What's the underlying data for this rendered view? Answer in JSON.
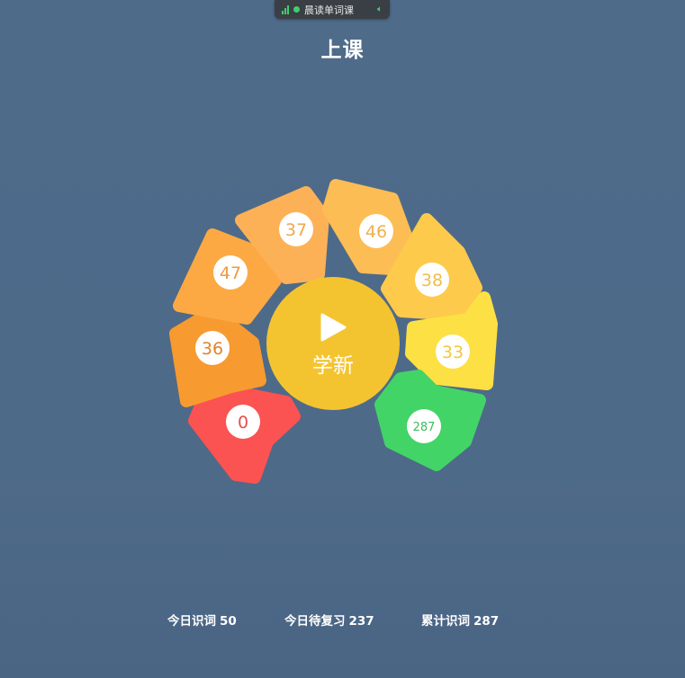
{
  "top_bar": {
    "app_name": "晨读单词课"
  },
  "page_title": "上课",
  "center_button": {
    "label": "学新",
    "color": "#f4c430"
  },
  "segments": [
    {
      "name": "0",
      "count": "0",
      "color": "#fb5252",
      "num_color": "#e4504c"
    },
    {
      "name": "36",
      "count": "36",
      "color": "#f79a2f",
      "num_color": "#e0842a"
    },
    {
      "name": "47",
      "count": "47",
      "color": "#fca944",
      "num_color": "#ee9a3e"
    },
    {
      "name": "37",
      "count": "37",
      "color": "#fdb156",
      "num_color": "#f0a650"
    },
    {
      "name": "46",
      "count": "46",
      "color": "#fdbd55",
      "num_color": "#f0b050"
    },
    {
      "name": "38",
      "count": "38",
      "color": "#fdca4b",
      "num_color": "#f2bd48"
    },
    {
      "name": "33",
      "count": "33",
      "color": "#fde044",
      "num_color": "#f2c83e"
    },
    {
      "name": "287",
      "count": "287",
      "color": "#42d467",
      "num_color": "#3bbd5d"
    }
  ],
  "stats": {
    "today_learned": {
      "label": "今日识词",
      "value": "50"
    },
    "today_review": {
      "label": "今日待复习",
      "value": "237"
    },
    "total_learned": {
      "label": "累计识词",
      "value": "287"
    }
  }
}
